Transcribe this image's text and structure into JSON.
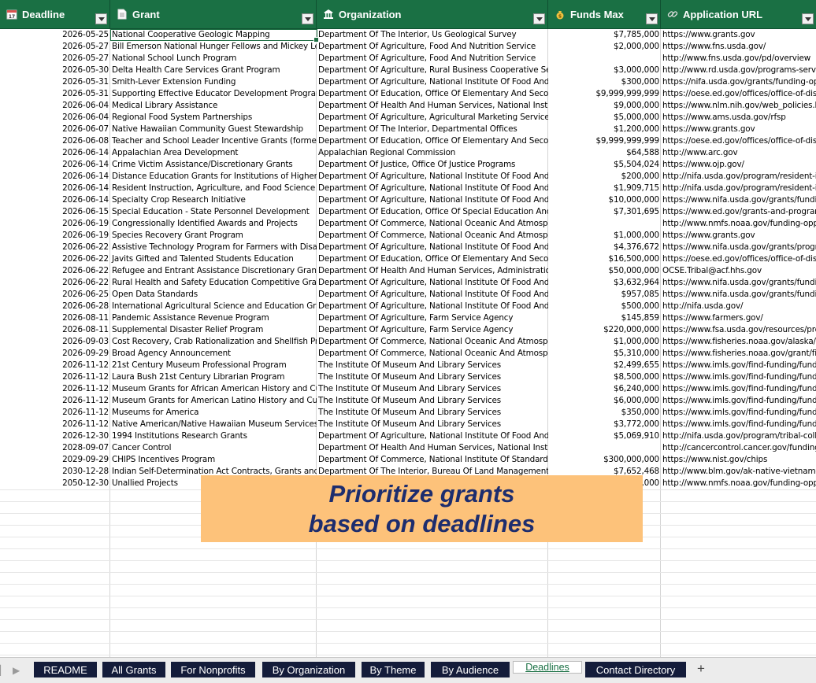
{
  "headers": [
    {
      "label": "Deadline",
      "icon": "calendar-icon"
    },
    {
      "label": "Grant",
      "icon": "document-icon"
    },
    {
      "label": "Organization",
      "icon": "building-icon"
    },
    {
      "label": "Funds Max",
      "icon": "money-bag-icon"
    },
    {
      "label": "Application URL",
      "icon": "link-icon"
    }
  ],
  "rows": [
    [
      "2026-05-25",
      "National Cooperative Geologic Mapping",
      "Department Of The Interior, Us Geological Survey",
      "$7,785,000",
      "https://www.grants.gov"
    ],
    [
      "2026-05-27",
      "Bill Emerson National Hunger Fellows and Mickey Leland International Hunger Fellows",
      "Department Of Agriculture, Food And Nutrition Service",
      "$2,000,000",
      "https://www.fns.usda.gov/"
    ],
    [
      "2026-05-27",
      "National School Lunch Program",
      "Department Of Agriculture, Food And Nutrition Service",
      "",
      "http://www.fns.usda.gov/pd/overview"
    ],
    [
      "2026-05-30",
      "Delta Health Care Services Grant Program",
      "Department Of Agriculture, Rural Business Cooperative Service",
      "$3,000,000",
      "http://www.rd.usda.gov/programs-services"
    ],
    [
      "2026-05-31",
      "Smith-Lever Extension Funding",
      "Department Of Agriculture, National Institute Of Food And Agriculture",
      "$300,000",
      "https://nifa.usda.gov/grants/funding-opportunities"
    ],
    [
      "2026-05-31",
      "Supporting Effective Educator Development Program",
      "Department Of Education, Office Of Elementary And Secondary Education",
      "$9,999,999,999",
      "https://oese.ed.gov/offices/office-of-discretionary"
    ],
    [
      "2026-06-04",
      "Medical Library Assistance",
      "Department Of Health And Human Services, National Institutes Of Health",
      "$9,000,000",
      "https://www.nlm.nih.gov/web_policies.html"
    ],
    [
      "2026-06-04",
      "Regional Food System Partnerships",
      "Department Of Agriculture, Agricultural Marketing Service",
      "$5,000,000",
      "https://www.ams.usda.gov/rfsp"
    ],
    [
      "2026-06-07",
      "Native Hawaiian Community Guest Stewardship",
      "Department Of The Interior, Departmental Offices",
      "$1,200,000",
      "https://www.grants.gov"
    ],
    [
      "2026-06-08",
      "Teacher and School Leader Incentive Grants (formerly the Teacher Incentive Fund)",
      "Department Of Education, Office Of Elementary And Secondary Education",
      "$9,999,999,999",
      "https://oese.ed.gov/offices/office-of-discretionary"
    ],
    [
      "2026-06-14",
      "Appalachian Area Development",
      "Appalachian Regional Commission",
      "$64,588",
      "http://www.arc.gov"
    ],
    [
      "2026-06-14",
      "Crime Victim Assistance/Discretionary Grants",
      "Department Of Justice, Office Of Justice Programs",
      "$5,504,024",
      "https://www.ojp.gov/"
    ],
    [
      "2026-06-14",
      "Distance Education Grants for Institutions of Higher Education in Insular Areas",
      "Department Of Agriculture, National Institute Of Food And Agriculture",
      "$200,000",
      "http://nifa.usda.gov/program/resident-instruction"
    ],
    [
      "2026-06-14",
      "Resident Instruction, Agriculture, and Food Science Facilities",
      "Department Of Agriculture, National Institute Of Food And Agriculture",
      "$1,909,715",
      "http://nifa.usda.gov/program/resident-instruction"
    ],
    [
      "2026-06-14",
      "Specialty Crop Research Initiative",
      "Department Of Agriculture, National Institute Of Food And Agriculture",
      "$10,000,000",
      "https://www.nifa.usda.gov/grants/funding-opportunities"
    ],
    [
      "2026-06-15",
      "Special Education - State Personnel Development",
      "Department Of Education, Office Of Special Education And Rehabilitative Services",
      "$7,301,695",
      "https://www.ed.gov/grants-and-programs/"
    ],
    [
      "2026-06-19",
      "Congressionally Identified Awards and  Projects",
      "Department Of Commerce, National Oceanic And Atmospheric Administration",
      "",
      "http://www.nmfs.noaa.gov/funding-opportunities"
    ],
    [
      "2026-06-19",
      "Species Recovery Grant Program",
      "Department Of Commerce, National Oceanic And Atmospheric Administration",
      "$1,000,000",
      "https://www.grants.gov"
    ],
    [
      "2026-06-22",
      "Assistive Technology Program for Farmers with Disabilities",
      "Department Of Agriculture, National Institute Of Food And Agriculture",
      "$4,376,672",
      "https://www.nifa.usda.gov/grants/programs"
    ],
    [
      "2026-06-22",
      "Javits Gifted and Talented Students Education",
      "Department Of Education, Office Of Elementary And Secondary Education",
      "$16,500,000",
      "https://oese.ed.gov/offices/office-of-discretionary"
    ],
    [
      "2026-06-22",
      "Refugee and Entrant Assistance Discretionary Grants",
      "Department Of Health And Human Services, Administration For Children And Families",
      "$50,000,000",
      "OCSE.Tribal@acf.hhs.gov"
    ],
    [
      "2026-06-22",
      "Rural Health and Safety Education Competitive Grants Program",
      "Department Of Agriculture, National Institute Of Food And Agriculture",
      "$3,632,964",
      "https://www.nifa.usda.gov/grants/funding-opportunities"
    ],
    [
      "2026-06-25",
      "Open Data Standards",
      "Department Of Agriculture, National Institute Of Food And Agriculture",
      "$957,085",
      "https://www.nifa.usda.gov/grants/funding-opportunities"
    ],
    [
      "2026-06-28",
      "International Agricultural Science and Education Grants",
      "Department Of Agriculture, National Institute Of Food And Agriculture",
      "$500,000",
      "http://nifa.usda.gov/"
    ],
    [
      "2026-08-11",
      "Pandemic Assistance Revenue Program",
      "Department Of Agriculture, Farm Service Agency",
      "$145,859",
      "https://www.farmers.gov/"
    ],
    [
      "2026-08-11",
      "Supplemental Disaster Relief Program",
      "Department Of Agriculture, Farm Service Agency",
      "$220,000,000",
      "https://www.fsa.usda.gov/resources/programs"
    ],
    [
      "2026-09-03",
      "Cost Recovery, Crab Rationalization and Shellfish Programs",
      "Department Of Commerce, National Oceanic And Atmospheric Administration",
      "$1,000,000",
      "https://www.fisheries.noaa.gov/alaska/commercial"
    ],
    [
      "2026-09-29",
      "Broad Agency Announcement",
      "Department Of Commerce, National Oceanic And Atmospheric Administration",
      "$5,310,000",
      "https://www.fisheries.noaa.gov/grant/fiscal"
    ],
    [
      "2026-11-12",
      "21st Century Museum Professional Program",
      "The Institute Of Museum And Library Services",
      "$2,499,655",
      "https://www.imls.gov/find-funding/funding"
    ],
    [
      "2026-11-12",
      "Laura Bush 21st Century Librarian Program",
      "The Institute Of Museum And Library Services",
      "$8,500,000",
      "https://www.imls.gov/find-funding/funding"
    ],
    [
      "2026-11-12",
      "Museum Grants for African American History and Culture",
      "The Institute Of Museum And Library Services",
      "$6,240,000",
      "https://www.imls.gov/find-funding/funding"
    ],
    [
      "2026-11-12",
      "Museum Grants for American Latino History and Culture",
      "The Institute Of Museum And Library Services",
      "$6,000,000",
      "https://www.imls.gov/find-funding/funding"
    ],
    [
      "2026-11-12",
      "Museums for America",
      "The Institute Of Museum And Library Services",
      "$350,000",
      "https://www.imls.gov/find-funding/funding"
    ],
    [
      "2026-11-12",
      "Native American/Native Hawaiian Museum Services Program",
      "The Institute Of Museum And Library Services",
      "$3,772,000",
      "https://www.imls.gov/find-funding/funding"
    ],
    [
      "2026-12-30",
      "1994 Institutions Research Grants",
      "Department Of Agriculture, National Institute Of Food And Agriculture",
      "$5,069,910",
      "http://nifa.usda.gov/program/tribal-colleges"
    ],
    [
      "2028-09-07",
      "Cancer Control",
      "Department Of Health And Human Services, National Institutes Of Health",
      "",
      "http://cancercontrol.cancer.gov/funding"
    ],
    [
      "2029-09-29",
      "CHIPS Incentives Program",
      "Department Of Commerce, National Institute Of Standards And Technology",
      "$300,000,000",
      "https://www.nist.gov/chips"
    ],
    [
      "2030-12-28",
      "Indian Self-Determination Act Contracts, Grants and Cooperative Agreements",
      "Department Of The Interior, Bureau Of Land Management",
      "$7,652,468",
      "http://www.blm.gov/ak-native-vietnam-veterans"
    ],
    [
      "2050-12-30",
      "Unallied Projects",
      "",
      "$1,000,000",
      "http://www.nmfs.noaa.gov/funding-opportunities"
    ]
  ],
  "overlay": {
    "line1": "Prioritize grants",
    "line2": "based on deadlines"
  },
  "tabs": [
    "README",
    "All Grants",
    "For Nonprofits",
    "By Organization",
    "By Theme",
    "By Audience",
    "Deadlines",
    "Contact Directory"
  ],
  "active_tab": "Deadlines",
  "add_tab_label": "+",
  "colors": {
    "header_bg": "#1a7044",
    "tab_bg": "#141c3a",
    "overlay_bg": "#fdc27a",
    "overlay_text": "#1d2d6e"
  }
}
